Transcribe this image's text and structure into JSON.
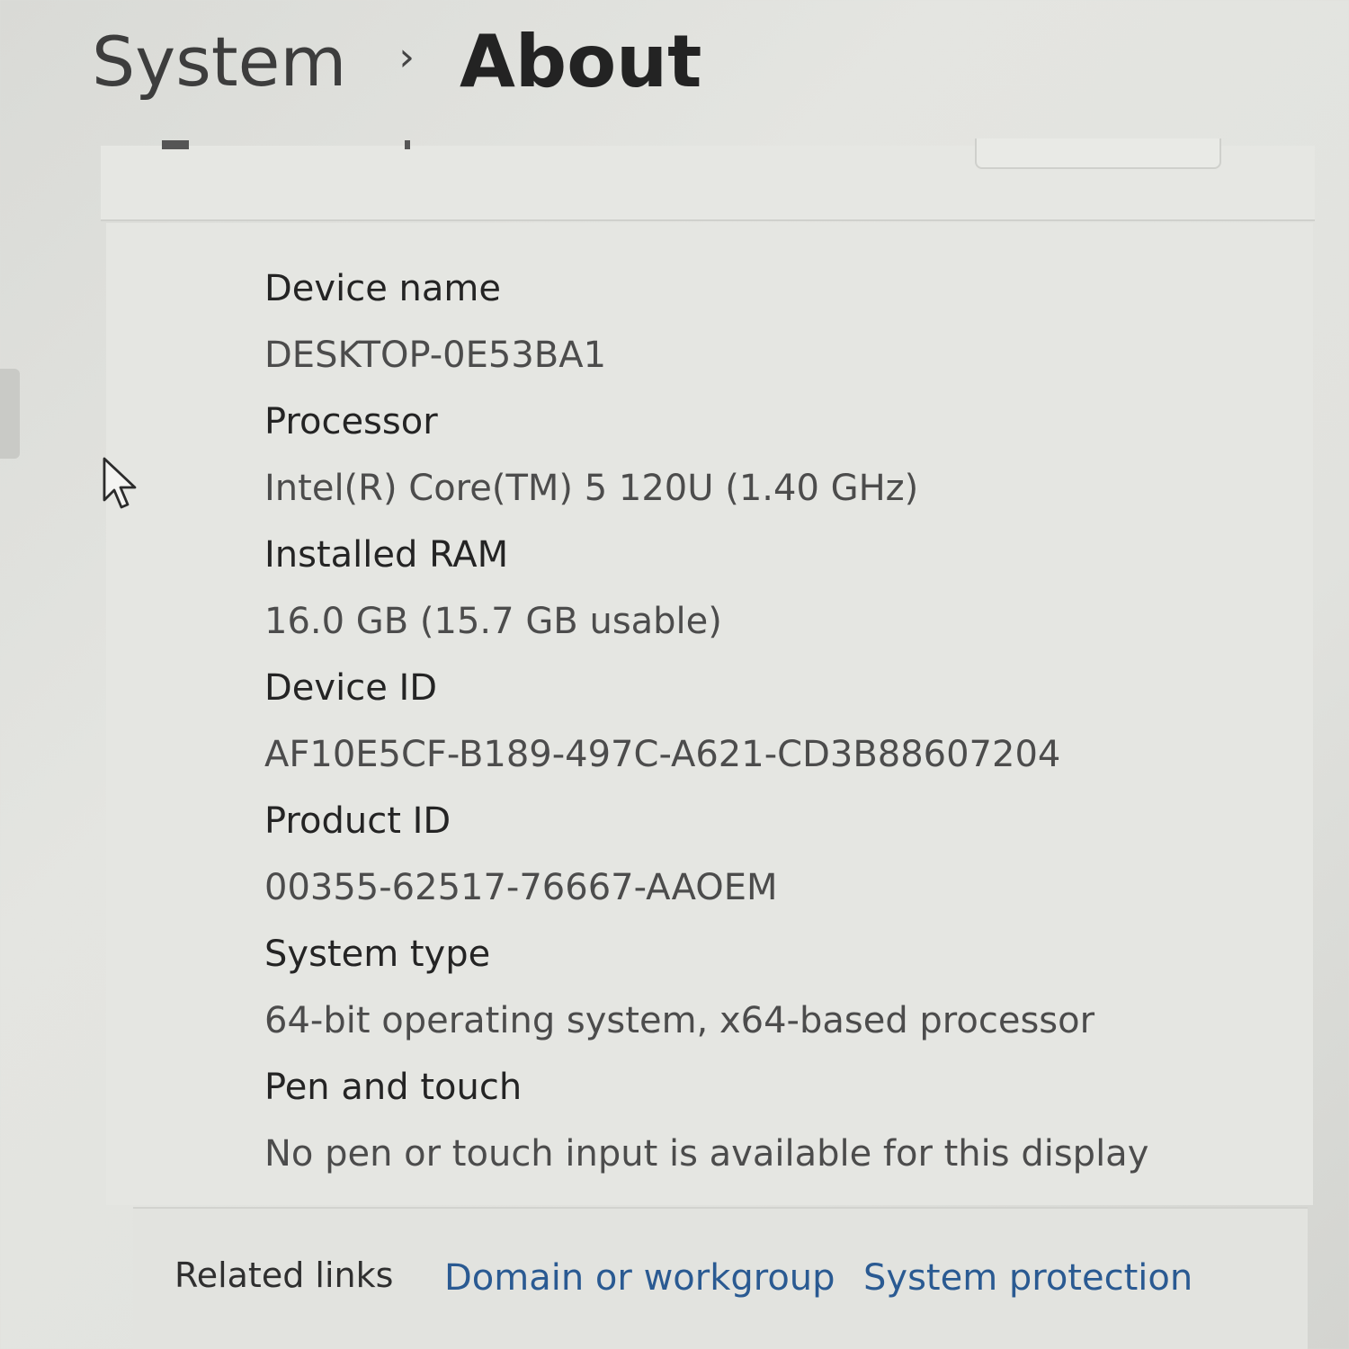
{
  "header": {
    "breadcrumb_parent": "System",
    "breadcrumb_separator_icon": "chevron-right-icon",
    "breadcrumb_current": "About"
  },
  "specs": [
    {
      "label": "Device name",
      "value": "DESKTOP-0E53BA1"
    },
    {
      "label": "Processor",
      "value": "Intel(R) Core(TM) 5 120U (1.40 GHz)"
    },
    {
      "label": "Installed RAM",
      "value": "16.0 GB (15.7 GB usable)"
    },
    {
      "label": "Device ID",
      "value": "AF10E5CF-B189-497C-A621-CD3B88607204"
    },
    {
      "label": "Product ID",
      "value": "00355-62517-76667-AAOEM"
    },
    {
      "label": "System type",
      "value": "64-bit operating system, x64-based processor"
    },
    {
      "label": "Pen and touch",
      "value": "No pen or touch input is available for this display"
    }
  ],
  "related": {
    "label": "Related links",
    "links": [
      "Domain or workgroup",
      "System protection"
    ]
  },
  "colors": {
    "background": "#e1e2de",
    "card": "#e5e6e2",
    "link": "#2a5a92",
    "label_text": "#242424",
    "value_text": "#4c4c4c"
  },
  "cursor_icon": "mouse-pointer-icon"
}
